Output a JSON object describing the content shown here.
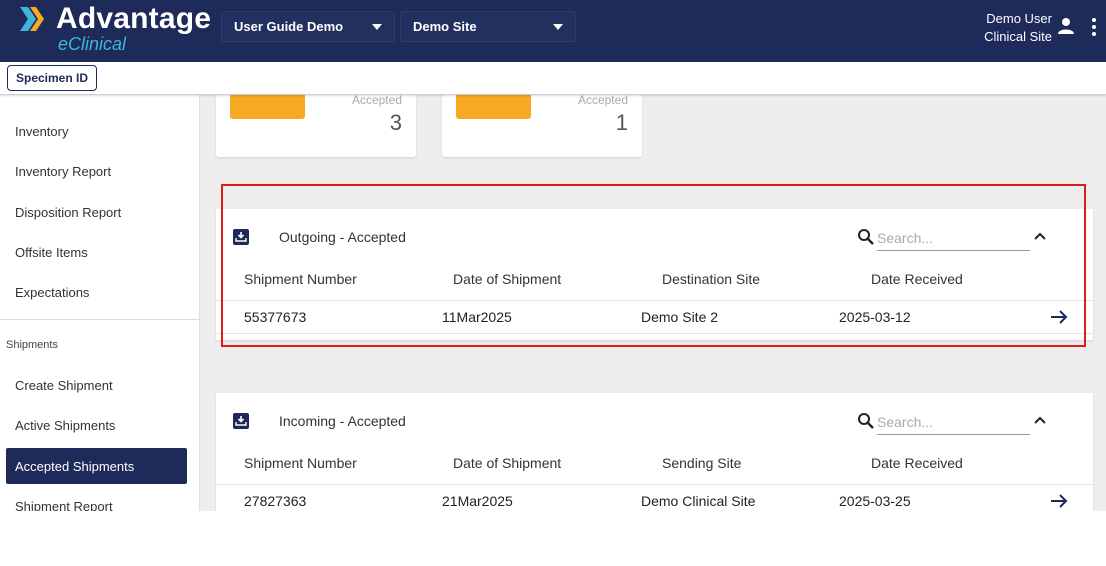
{
  "header": {
    "logo_title": "Advantage",
    "logo_subtitle": "eClinical",
    "study_select": "User Guide Demo",
    "site_select": "Demo Site",
    "user_name": "Demo User",
    "user_role": "Clinical Site"
  },
  "subbar": {
    "chip_label": "Specimen ID"
  },
  "sidebar": {
    "items": [
      "Inventory",
      "Inventory Report",
      "Disposition Report",
      "Offsite Items",
      "Expectations"
    ],
    "section_label": "Shipments",
    "shipment_items": [
      "Create Shipment",
      "Active Shipments",
      "Accepted Shipments",
      "Shipment Report"
    ],
    "active_item": "Accepted Shipments"
  },
  "stats": [
    {
      "label": "Accepted",
      "value": "3"
    },
    {
      "label": "Accepted",
      "value": "1"
    }
  ],
  "outgoing": {
    "title": "Outgoing - Accepted",
    "search_placeholder": "Search...",
    "columns": [
      "Shipment Number",
      "Date of Shipment",
      "Destination Site",
      "Date Received"
    ],
    "rows": [
      {
        "shipment_number": "55377673",
        "date_of_shipment": "11Mar2025",
        "site": "Demo Site 2",
        "date_received": "2025-03-12"
      }
    ]
  },
  "incoming": {
    "title": "Incoming - Accepted",
    "search_placeholder": "Search...",
    "columns": [
      "Shipment Number",
      "Date of Shipment",
      "Sending Site",
      "Date Received"
    ],
    "rows": [
      {
        "shipment_number": "27827363",
        "date_of_shipment": "21Mar2025",
        "site": "Demo Clinical Site",
        "date_received": "2025-03-25"
      }
    ]
  },
  "colors": {
    "navy": "#1d2a5a",
    "accent_orange": "#f7a824",
    "logo_cyan": "#3fb6d8",
    "highlight_red": "#e01b1b"
  },
  "icons": [
    "logo-chevron-icon",
    "chevron-down-icon",
    "person-icon",
    "more-vert-icon",
    "inbox-icon",
    "search-icon",
    "chevron-up-icon",
    "arrow-right-icon"
  ]
}
